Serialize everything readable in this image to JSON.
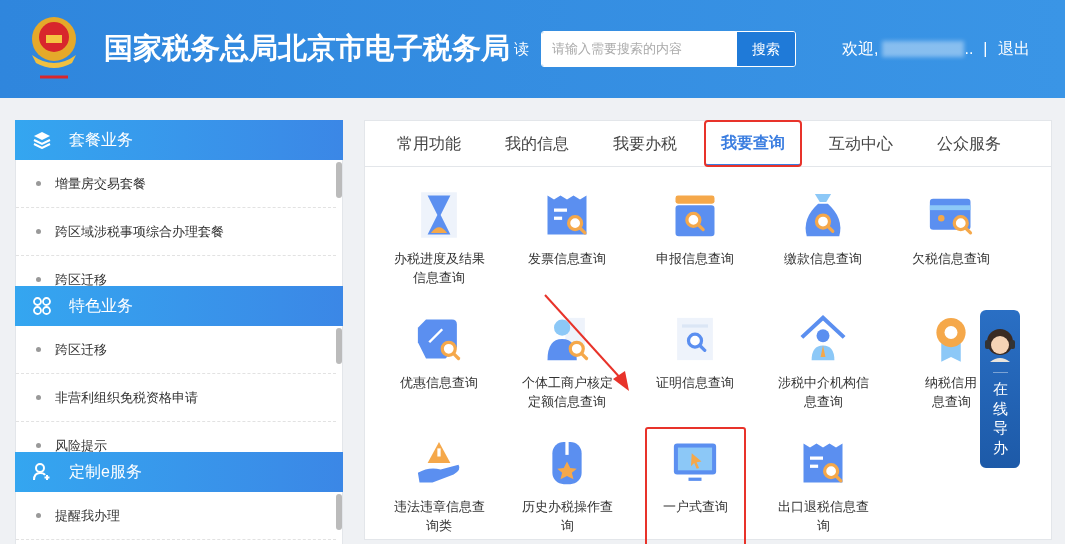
{
  "header": {
    "title": "国家税务总局北京市电子税务局",
    "nav_fragment": "读",
    "search": {
      "placeholder": "请输入需要搜索的内容",
      "button": "搜索"
    },
    "welcome": "欢迎,",
    "user_suffix": "..",
    "separator": "|",
    "logout": "退出"
  },
  "sidebar": {
    "sections": [
      {
        "title": "套餐业务",
        "items": [
          "增量房交易套餐",
          "跨区域涉税事项综合办理套餐",
          "跨区迁移"
        ]
      },
      {
        "title": "特色业务",
        "items": [
          "跨区迁移",
          "非营利组织免税资格申请",
          "风险提示"
        ]
      },
      {
        "title": "定制e服务",
        "items": [
          "提醒我办理"
        ]
      }
    ]
  },
  "tabs": [
    {
      "label": "常用功能",
      "selected": false,
      "highlighted": false
    },
    {
      "label": "我的信息",
      "selected": false,
      "highlighted": false
    },
    {
      "label": "我要办税",
      "selected": false,
      "highlighted": false
    },
    {
      "label": "我要查询",
      "selected": true,
      "highlighted": true
    },
    {
      "label": "互动中心",
      "selected": false,
      "highlighted": false
    },
    {
      "label": "公众服务",
      "selected": false,
      "highlighted": false
    }
  ],
  "grid_items": [
    {
      "lines": [
        "办税进度及结果",
        "信息查询"
      ],
      "highlighted": false
    },
    {
      "lines": [
        "发票信息查询"
      ],
      "highlighted": false
    },
    {
      "lines": [
        "申报信息查询"
      ],
      "highlighted": false
    },
    {
      "lines": [
        "缴款信息查询"
      ],
      "highlighted": false
    },
    {
      "lines": [
        "欠税信息查询"
      ],
      "highlighted": false
    },
    {
      "lines": [
        "优惠信息查询"
      ],
      "highlighted": false
    },
    {
      "lines": [
        "个体工商户核定",
        "定额信息查询"
      ],
      "highlighted": false
    },
    {
      "lines": [
        "证明信息查询"
      ],
      "highlighted": false
    },
    {
      "lines": [
        "涉税中介机构信",
        "息查询"
      ],
      "highlighted": false
    },
    {
      "lines": [
        "纳税信用",
        "息查询"
      ],
      "highlighted": false
    },
    {
      "lines": [
        "违法违章信息查",
        "询类"
      ],
      "highlighted": false
    },
    {
      "lines": [
        "历史办税操作查",
        "询"
      ],
      "highlighted": false
    },
    {
      "lines": [
        "一户式查询"
      ],
      "highlighted": true
    },
    {
      "lines": [
        "出口退税信息查",
        "询"
      ],
      "highlighted": false
    }
  ],
  "online_guide": {
    "label": "在线导办"
  }
}
